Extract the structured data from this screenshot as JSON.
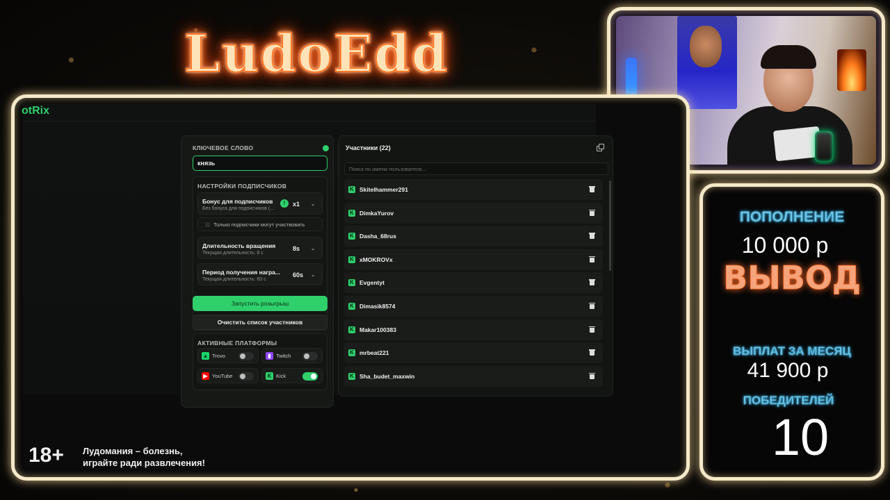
{
  "logo": {
    "text": "LudoEdd"
  },
  "app": {
    "brand": "otRix",
    "keyword": {
      "label": "КЛЮЧЕВОЕ СЛОВО",
      "value": "князь"
    },
    "subscriber_settings": {
      "title": "НАСТРОЙКИ ПОДПИСЧИКОВ",
      "bonus": {
        "title": "Бонус для подписчиков",
        "subtitle": "Без бонуса для подписчиков (...",
        "value": "x1"
      },
      "subs_only": {
        "label": "Только подписчики могут участвовать"
      },
      "spin_duration": {
        "title": "Длительность вращения",
        "subtitle": "Текущая длительность: 8 с",
        "value": "8s"
      },
      "reward_period": {
        "title": "Период получения награ...",
        "subtitle": "Текущая длительность: 60 с",
        "value": "60s"
      }
    },
    "buttons": {
      "start": "Запустить розыгрыш",
      "clear": "Очистить список участников"
    },
    "platforms": {
      "title": "АКТИВНЫЕ ПЛАТФОРМЫ",
      "items": [
        {
          "name": "Trovo",
          "icon": "trovo-icon",
          "enabled": false,
          "color": "#19d66b"
        },
        {
          "name": "Twitch",
          "icon": "twitch-icon",
          "enabled": false,
          "color": "#9146ff"
        },
        {
          "name": "YouTube",
          "icon": "youtube-icon",
          "enabled": false,
          "color": "#ff0000"
        },
        {
          "name": "Kick",
          "icon": "kick-icon",
          "enabled": true,
          "color": "#2fd06b"
        }
      ]
    },
    "participants": {
      "title": "Участники (22)",
      "search_placeholder": "Поиск по имени пользователя...",
      "items": [
        "Skitelhammer291",
        "DimkaYurov",
        "Dasha_68rus",
        "xMOKROVx",
        "Evgentyt",
        "Dimasik8574",
        "Makar100383",
        "mrbeat221",
        "Sha_budet_maxwin"
      ]
    }
  },
  "disclaimer": {
    "age": "18+",
    "line1": "Лудомания – болезнь,",
    "line2": "играйте ради развлечения!"
  },
  "stats": {
    "deposit_label": "ПОПОЛНЕНИЕ",
    "deposit_value": "10 000 р",
    "withdraw_label": "ВЫВОД",
    "payouts_label": "ВЫПЛАТ ЗА МЕСЯЦ",
    "payouts_value": "41 900 р",
    "winners_label": "ПОБЕДИТЕЛЕЙ",
    "winners_value": "10"
  },
  "colors": {
    "accent": "#2fd06b",
    "frame": "#f4e9c8",
    "stat_label": "#74c8e8",
    "withdraw": "#f5a37a"
  }
}
